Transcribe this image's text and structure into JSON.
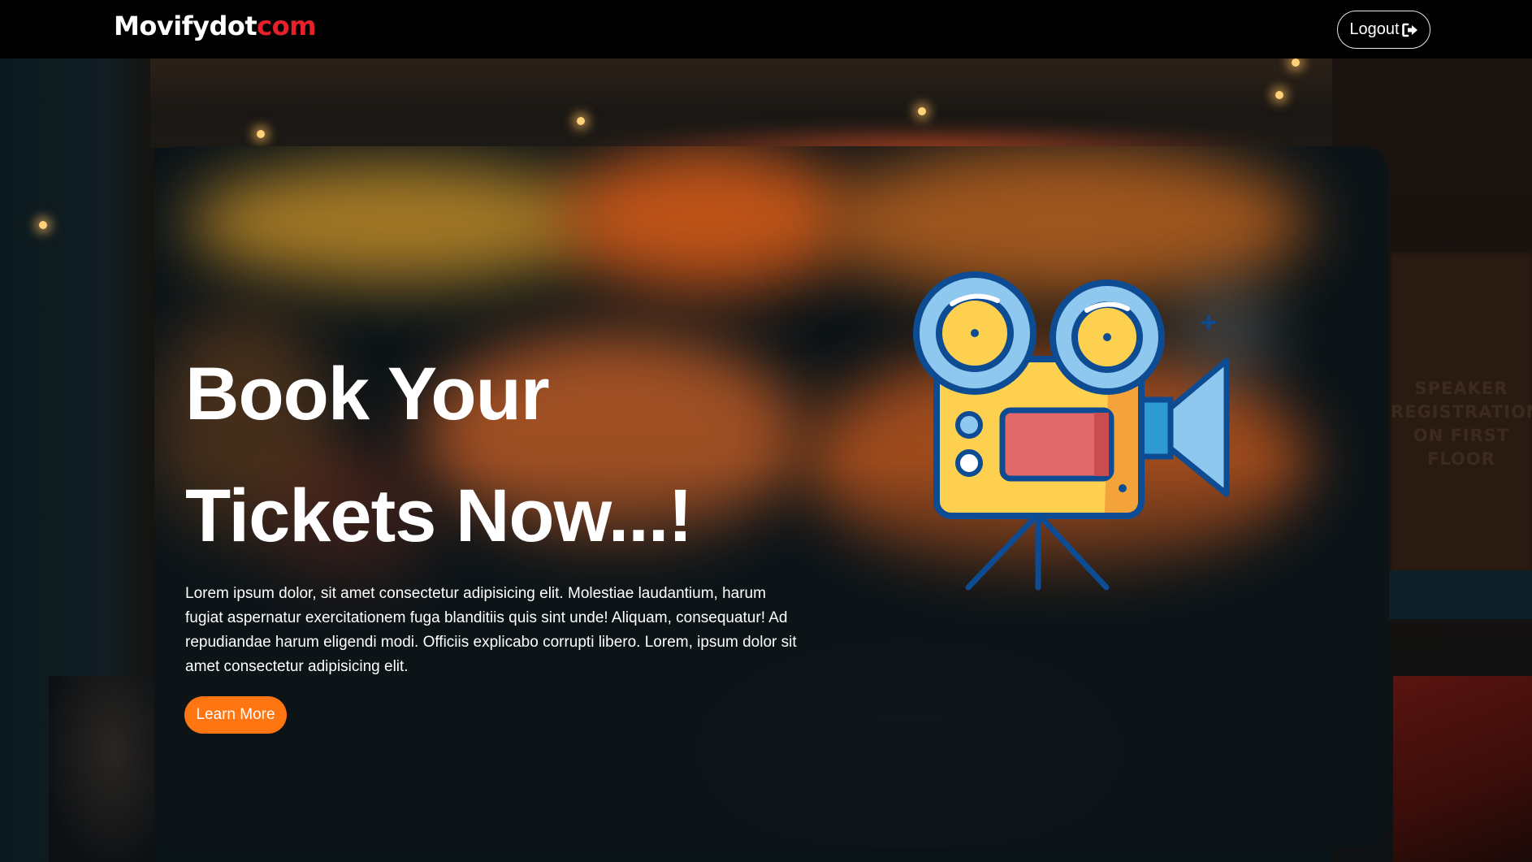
{
  "navbar": {
    "brand_main": "Movifydot",
    "brand_accent": "com",
    "logout_label": "Logout",
    "logout_icon": "sign-out-icon"
  },
  "backdrop": {
    "sign_text": "SPEAKER REGISTRATION ON FIRST FLOOR"
  },
  "hero": {
    "title_line1": "Book Your",
    "title_line2": "Tickets Now...!",
    "description": "Lorem ipsum dolor, sit amet consectetur adipisicing elit. Molestiae laudantium, harum fugiat aspernatur exercitationem fuga blanditiis quis sint unde! Aliquam, consequatur! Ad repudiandae harum eligendi modi. Officiis explicabo corrupti libero. Lorem, ipsum dolor sit amet consectetur adipisicing elit.",
    "cta_label": "Learn More",
    "illustration": "movie-camera-icon"
  },
  "colors": {
    "navbar_bg": "#000000",
    "brand_accent": "#e8202a",
    "cta_bg": "#ff7512",
    "camera_body": "#fdd14f",
    "camera_outline": "#0d4b93",
    "camera_screen": "#e2696a",
    "camera_lens": "#8ec8ef"
  }
}
